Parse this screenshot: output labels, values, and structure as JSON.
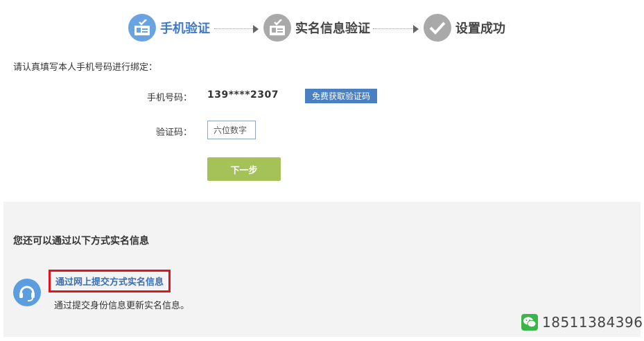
{
  "steps": [
    {
      "label": "手机验证",
      "color": "#3f79c8",
      "icon": "id-card-check-icon"
    },
    {
      "label": "实名信息验证",
      "color": "#444444",
      "icon": "id-card-check-icon"
    },
    {
      "label": "设置成功",
      "color": "#444444",
      "icon": "checkmark-icon"
    }
  ],
  "form": {
    "intro": "请认真填写本人手机号码进行绑定：",
    "phone_label": "手机号码：",
    "phone_value": "139****2307",
    "sms_button": "免费获取验证码",
    "code_label": "验证码：",
    "code_placeholder": "六位数字",
    "next_button": "下一步"
  },
  "alt": {
    "title": "您还可以通过以下方式实名信息",
    "link": "通过网上提交方式实名信息",
    "desc": "通过提交身份信息更新实名信息。",
    "icon": "headset-icon"
  },
  "watermark": {
    "text": "18511384396",
    "icon": "wechat-icon"
  },
  "colors": {
    "accent": "#4a7fc1",
    "next": "#a5c259",
    "highlight": "#e2141b",
    "step_active": "#6aa3e2",
    "step_inactive": "#a9a9a9"
  }
}
